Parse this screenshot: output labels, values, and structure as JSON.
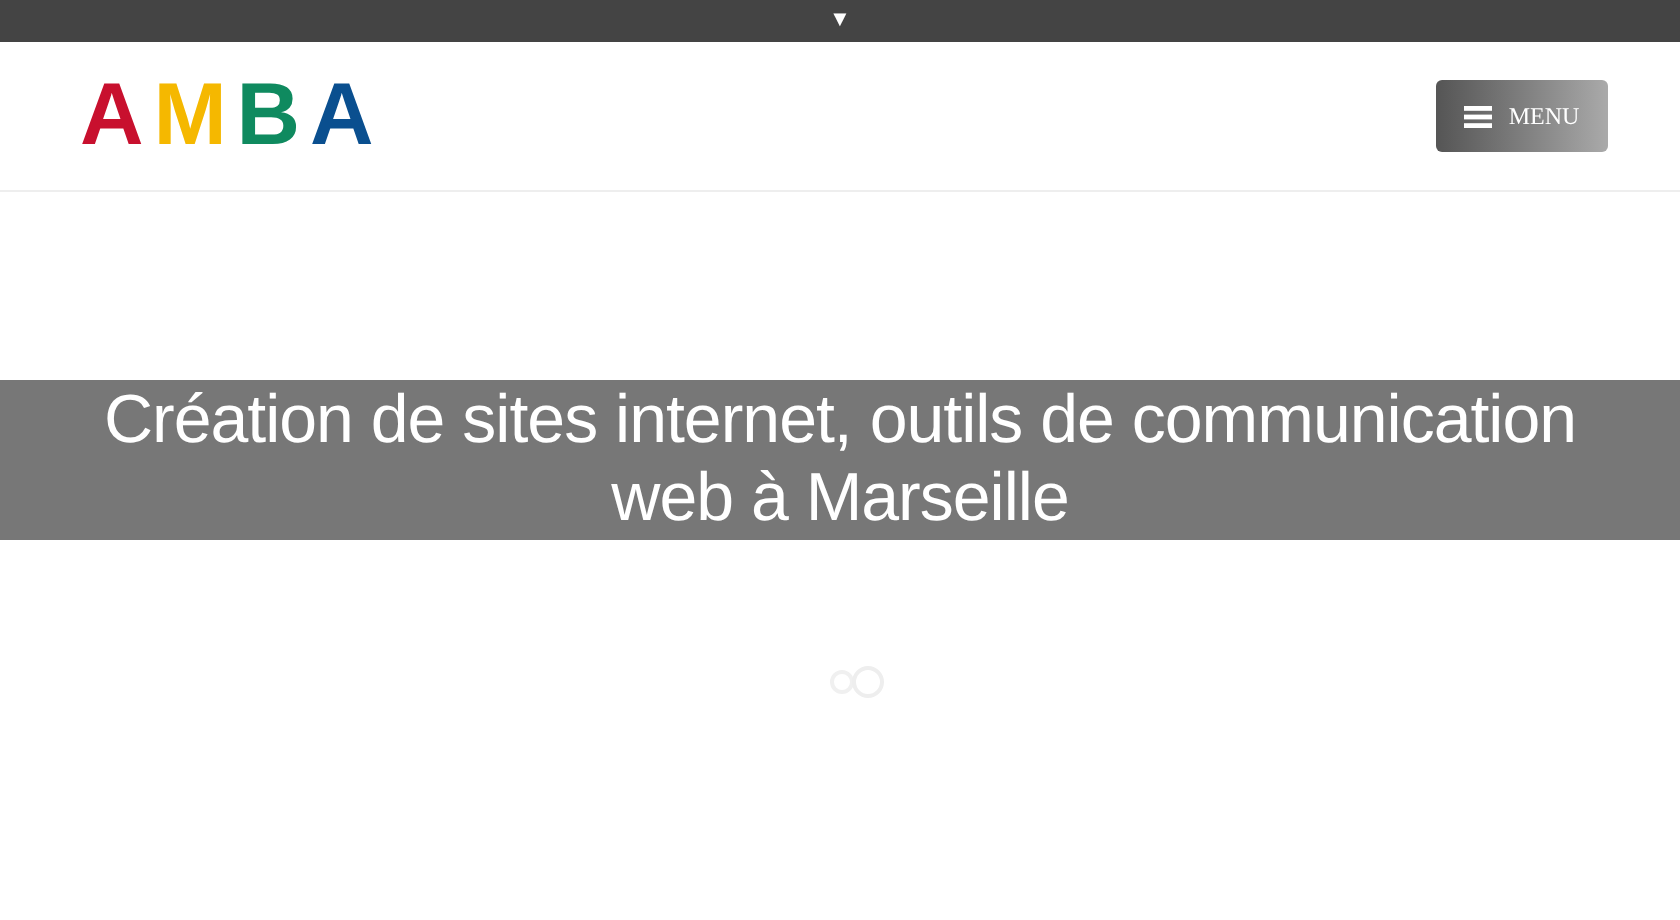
{
  "top_bar": {
    "toggle": "▼"
  },
  "header": {
    "logo": [
      {
        "letter": "A",
        "color": "#c8102e"
      },
      {
        "letter": "M",
        "color": "#f5b800"
      },
      {
        "letter": "B",
        "color": "#0f8a5f"
      },
      {
        "letter": "A",
        "color": "#0a4f8f"
      }
    ],
    "menu_button": {
      "label": "MENU"
    }
  },
  "banner": {
    "title": "Création de sites internet, outils de communication web à Marseille"
  }
}
